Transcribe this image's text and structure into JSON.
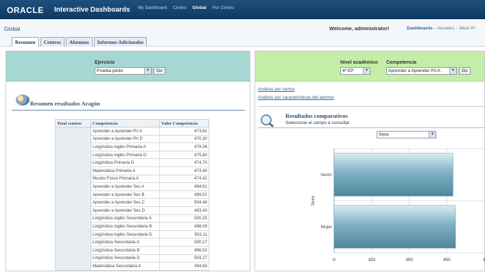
{
  "topbar": {
    "logo": "ORACLE",
    "app_title": "Interactive Dashboards",
    "nav": [
      "My Dashboard",
      "Centro",
      "Global",
      "Por Centro"
    ],
    "active_nav": "Global"
  },
  "header": {
    "dashboard_name": "Global",
    "welcome": "Welcome, administrator!",
    "links": {
      "dashboards": "Dashboards",
      "rest": " – Answers – More Pr"
    }
  },
  "tabs": [
    "Resumen",
    "Centros",
    "Alumnos",
    "Informes Adicionales"
  ],
  "left_prompt": {
    "label": "Ejercicio",
    "value": "Prueba piloto",
    "go": "Go"
  },
  "right_prompt": {
    "nivel_label": "Nivel académico",
    "nivel_value": "4º EP",
    "competencia_label": "Competencia",
    "competencia_value": "Aprender a Aprender Pri A",
    "go": "Go"
  },
  "left_section": {
    "title": "Resumen resultados Aragón",
    "table": {
      "headers": [
        "Total centros",
        "Competencia",
        "Valor Competencia"
      ],
      "rows": [
        [
          "Aprender a Aprender Pri A",
          "473,82"
        ],
        [
          "Aprender a Aprender Pri D",
          "470,30"
        ],
        [
          "Lingüística inglés Primaria A",
          "479,36"
        ],
        [
          "Lingüística inglés Primaria D",
          "475,80"
        ],
        [
          "Lingüística Primaria D",
          "474,70"
        ],
        [
          "Matemática Primaria A",
          "473,40"
        ],
        [
          "Mundo Físico Primaria A",
          "474,42"
        ],
        [
          "Aprender a Aprender Sec A",
          "494,61"
        ],
        [
          "Aprender a Aprender Sec B",
          "499,02"
        ],
        [
          "Aprender a Aprender Sec C",
          "504,48"
        ],
        [
          "Aprender a Aprender Sec D",
          "493,43"
        ],
        [
          "Lingüística inglés Secundaria A",
          "500,25"
        ],
        [
          "Lingüística inglés Secundaria B",
          "498,09"
        ],
        [
          "Lingüística inglés Secundaria D",
          "503,11"
        ],
        [
          "Lingüística Secundaria A",
          "500,17"
        ],
        [
          "Lingüística Secundaria B",
          "496,53"
        ],
        [
          "Lingüística Secundaria D",
          "503,27"
        ],
        [
          "Matemática Secundaria A",
          "494,63"
        ]
      ]
    }
  },
  "right_section": {
    "links": [
      "Análisis por centro",
      "Análisis por características del alumno"
    ],
    "title": "Resultados comparativos",
    "subtitle": "Seleccione el campo a consultar",
    "field_select": "Sexo"
  },
  "chart_data": {
    "type": "bar",
    "orientation": "horizontal",
    "categories": [
      "Varón",
      "Mujer"
    ],
    "values": [
      475,
      485
    ],
    "ylabel": "Sexo",
    "xlim": [
      0,
      600
    ],
    "xticks": [
      "0",
      "150",
      "300",
      "450",
      "6"
    ],
    "grid": true,
    "bar_color": "#7fb0c4"
  }
}
